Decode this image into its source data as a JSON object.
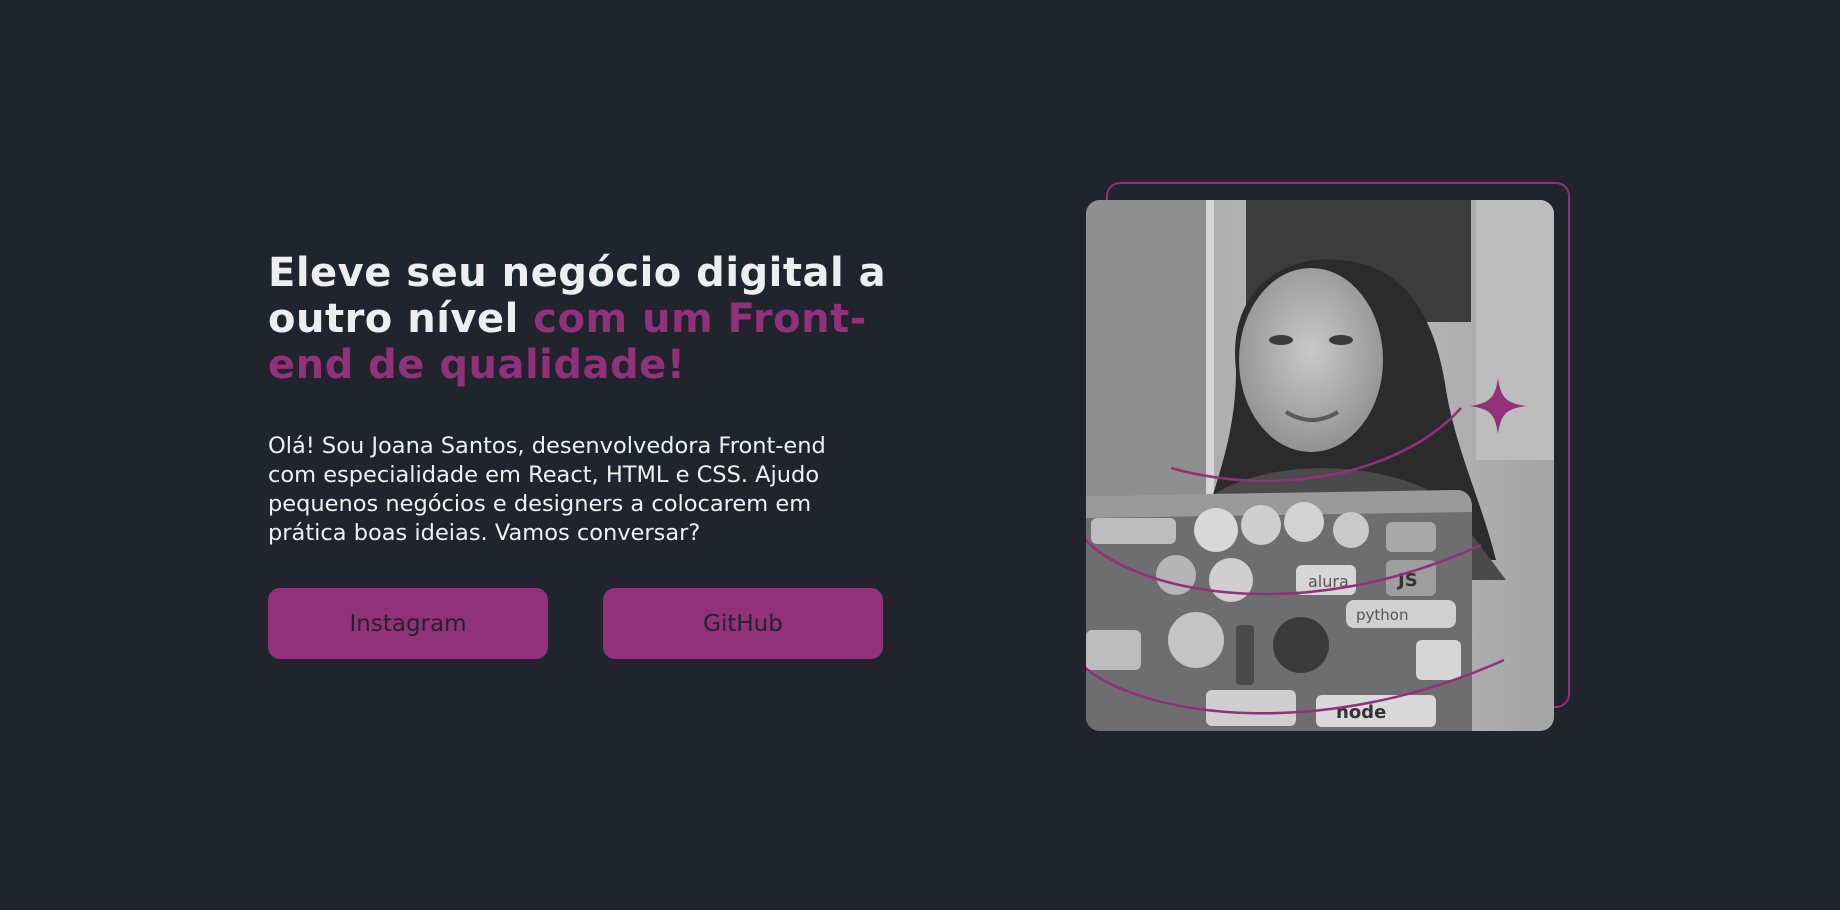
{
  "hero": {
    "headline_white": "Eleve seu negócio digital a outro nível",
    "headline_accent": "com um Front-end de qualidade!",
    "intro": "Olá! Sou Joana Santos, desenvolvedora Front-end com especialidade em React, HTML e CSS. Ajudo pequenos negócios e designers a colocarem em prática boas ideias. Vamos conversar?"
  },
  "buttons": {
    "instagram": "Instagram",
    "github": "GitHub"
  },
  "colors": {
    "background": "#1f242d",
    "accent": "#913177",
    "text": "#eeeeee"
  },
  "photo": {
    "description_icon": "portrait-photo",
    "sticker_texts": [
      "alura",
      "JS",
      "python",
      "node"
    ]
  }
}
